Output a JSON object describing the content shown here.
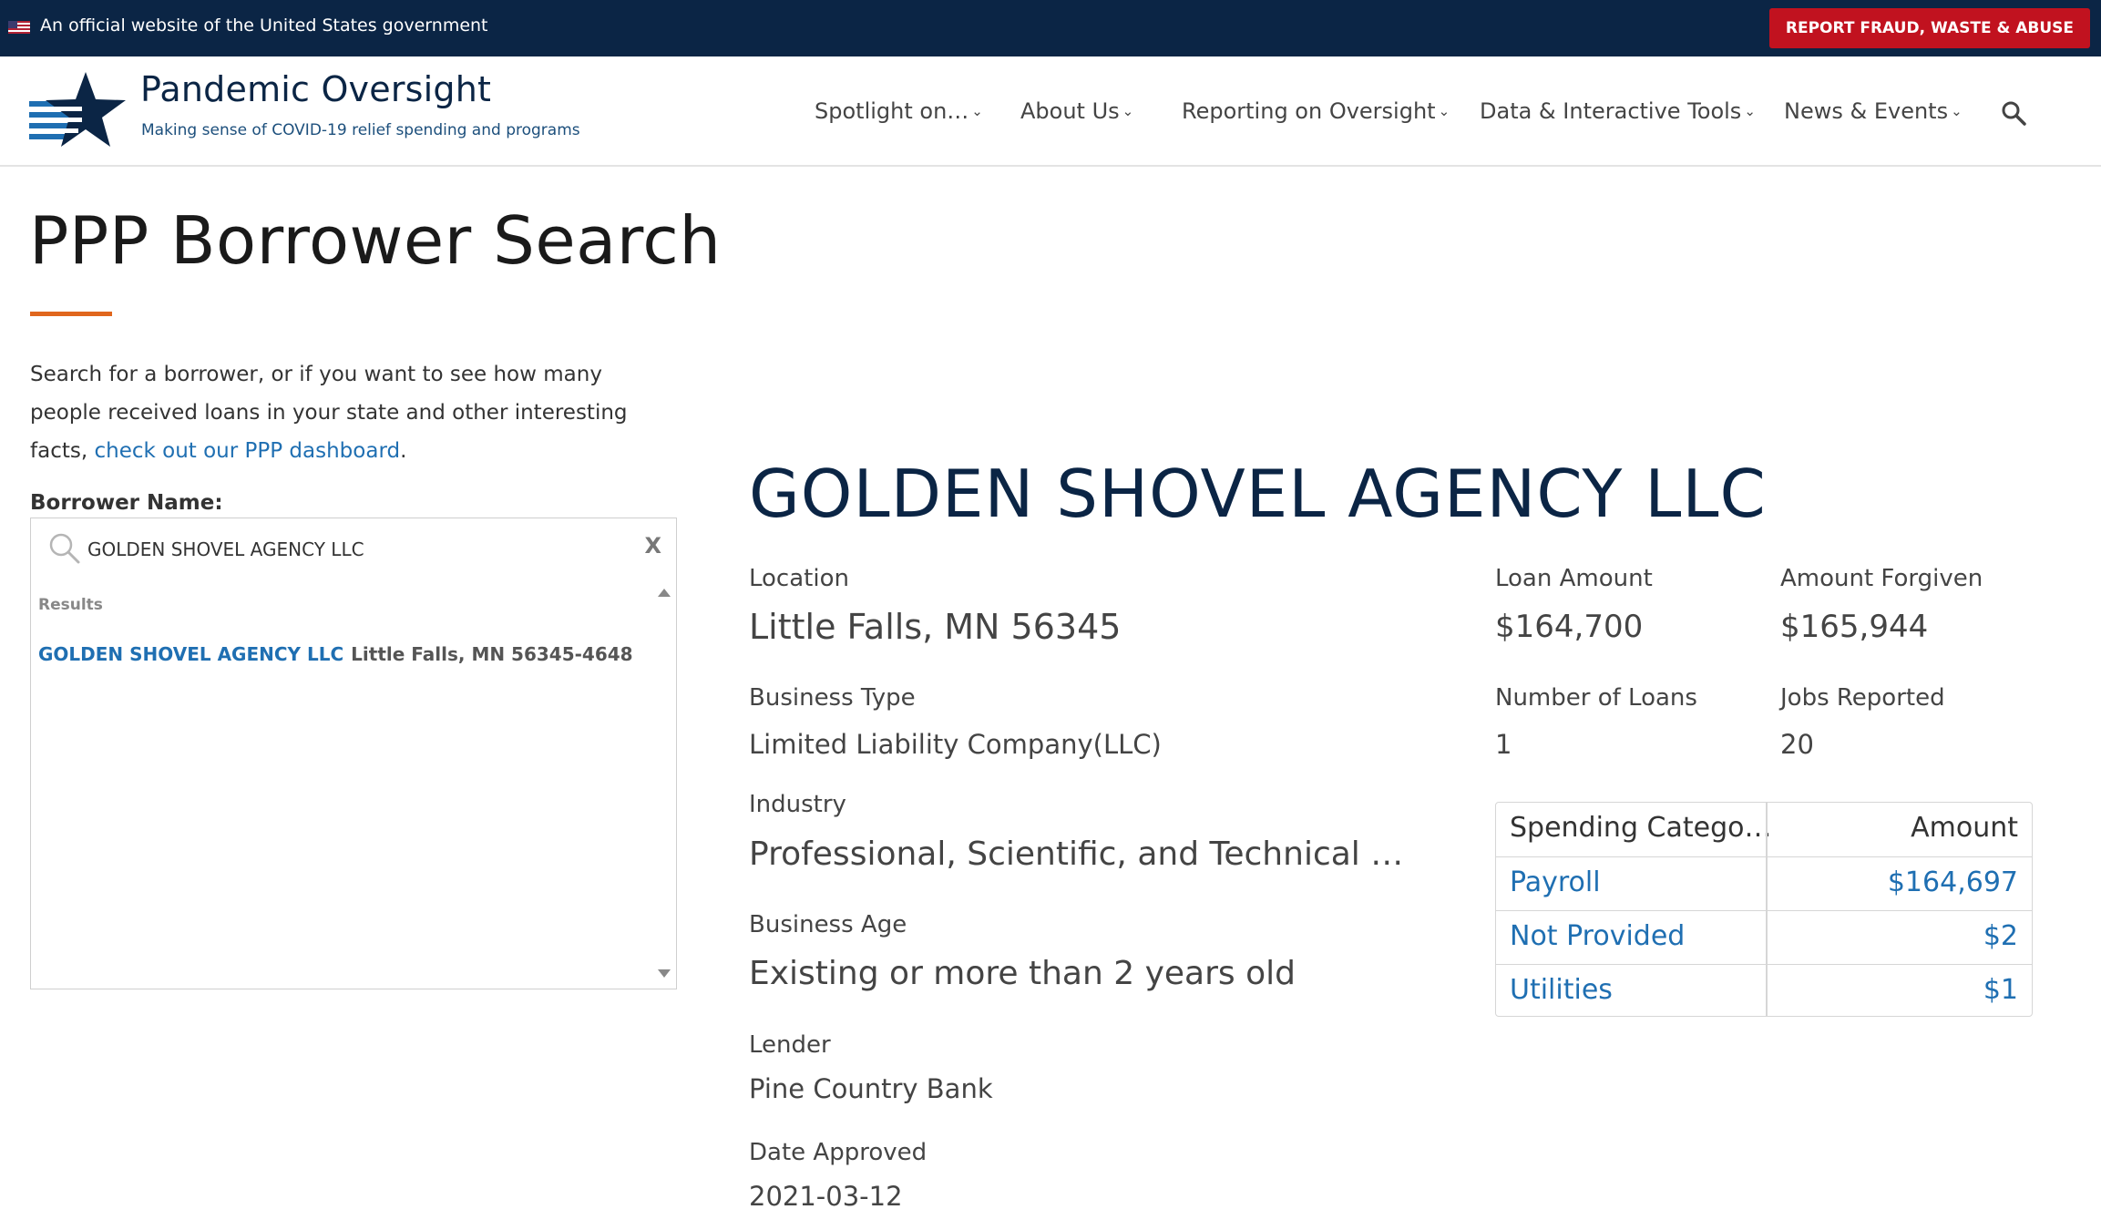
{
  "gov_banner": {
    "text": "An official website of the United States government",
    "report_button": "REPORT FRAUD, WASTE & ABUSE"
  },
  "brand": {
    "title_light": "Pandemic ",
    "title_strong": "Oversight",
    "tagline": "Making sense of COVID-19 relief spending and programs"
  },
  "nav": {
    "items": [
      {
        "label": "Spotlight on…"
      },
      {
        "label": "About Us"
      },
      {
        "label": "Reporting on Oversight"
      },
      {
        "label": "Data & Interactive Tools"
      },
      {
        "label": "News & Events"
      }
    ],
    "chevron": "⌄"
  },
  "page": {
    "title": "PPP Borrower Search",
    "intro_text": "Search for a borrower, or if you want to see how many people received loans in your state and other interesting facts, ",
    "intro_link": "check out our PPP dashboard",
    "intro_end": "."
  },
  "search": {
    "label": "Borrower Name:",
    "value": "GOLDEN SHOVEL AGENCY LLC",
    "clear": "X",
    "results_label": "Results",
    "results": [
      {
        "name": "GOLDEN SHOVEL AGENCY LLC",
        "location": "Little Falls, MN 56345-4648"
      }
    ]
  },
  "borrower": {
    "name": "GOLDEN SHOVEL AGENCY LLC",
    "location_label": "Location",
    "location": "Little Falls, MN 56345",
    "business_type_label": "Business Type",
    "business_type": "Limited  Liability Company(LLC)",
    "industry_label": "Industry",
    "industry": "Professional, Scientific, and Technical …",
    "business_age_label": "Business Age",
    "business_age": "Existing or more than 2 years old",
    "lender_label": "Lender",
    "lender": "Pine Country Bank",
    "date_label": "Date Approved",
    "date": "2021-03-12",
    "loan_amount_label": "Loan Amount",
    "loan_amount": "$164,700",
    "forgiven_label": "Amount Forgiven",
    "forgiven": "$165,944",
    "loans_label": "Number of Loans",
    "loans": "1",
    "jobs_label": "Jobs Reported",
    "jobs": "20"
  },
  "spending": {
    "col1": "Spending Catego…",
    "col2": "Amount",
    "rows": [
      {
        "category": "Payroll",
        "amount": "$164,697"
      },
      {
        "category": "Not Provided",
        "amount": "$2"
      },
      {
        "category": "Utilities",
        "amount": "$1"
      }
    ]
  },
  "colors": {
    "navy": "#0b2545",
    "report_red": "#c1121f",
    "link_blue": "#1f6fb2",
    "accent_orange": "#e0661d"
  }
}
